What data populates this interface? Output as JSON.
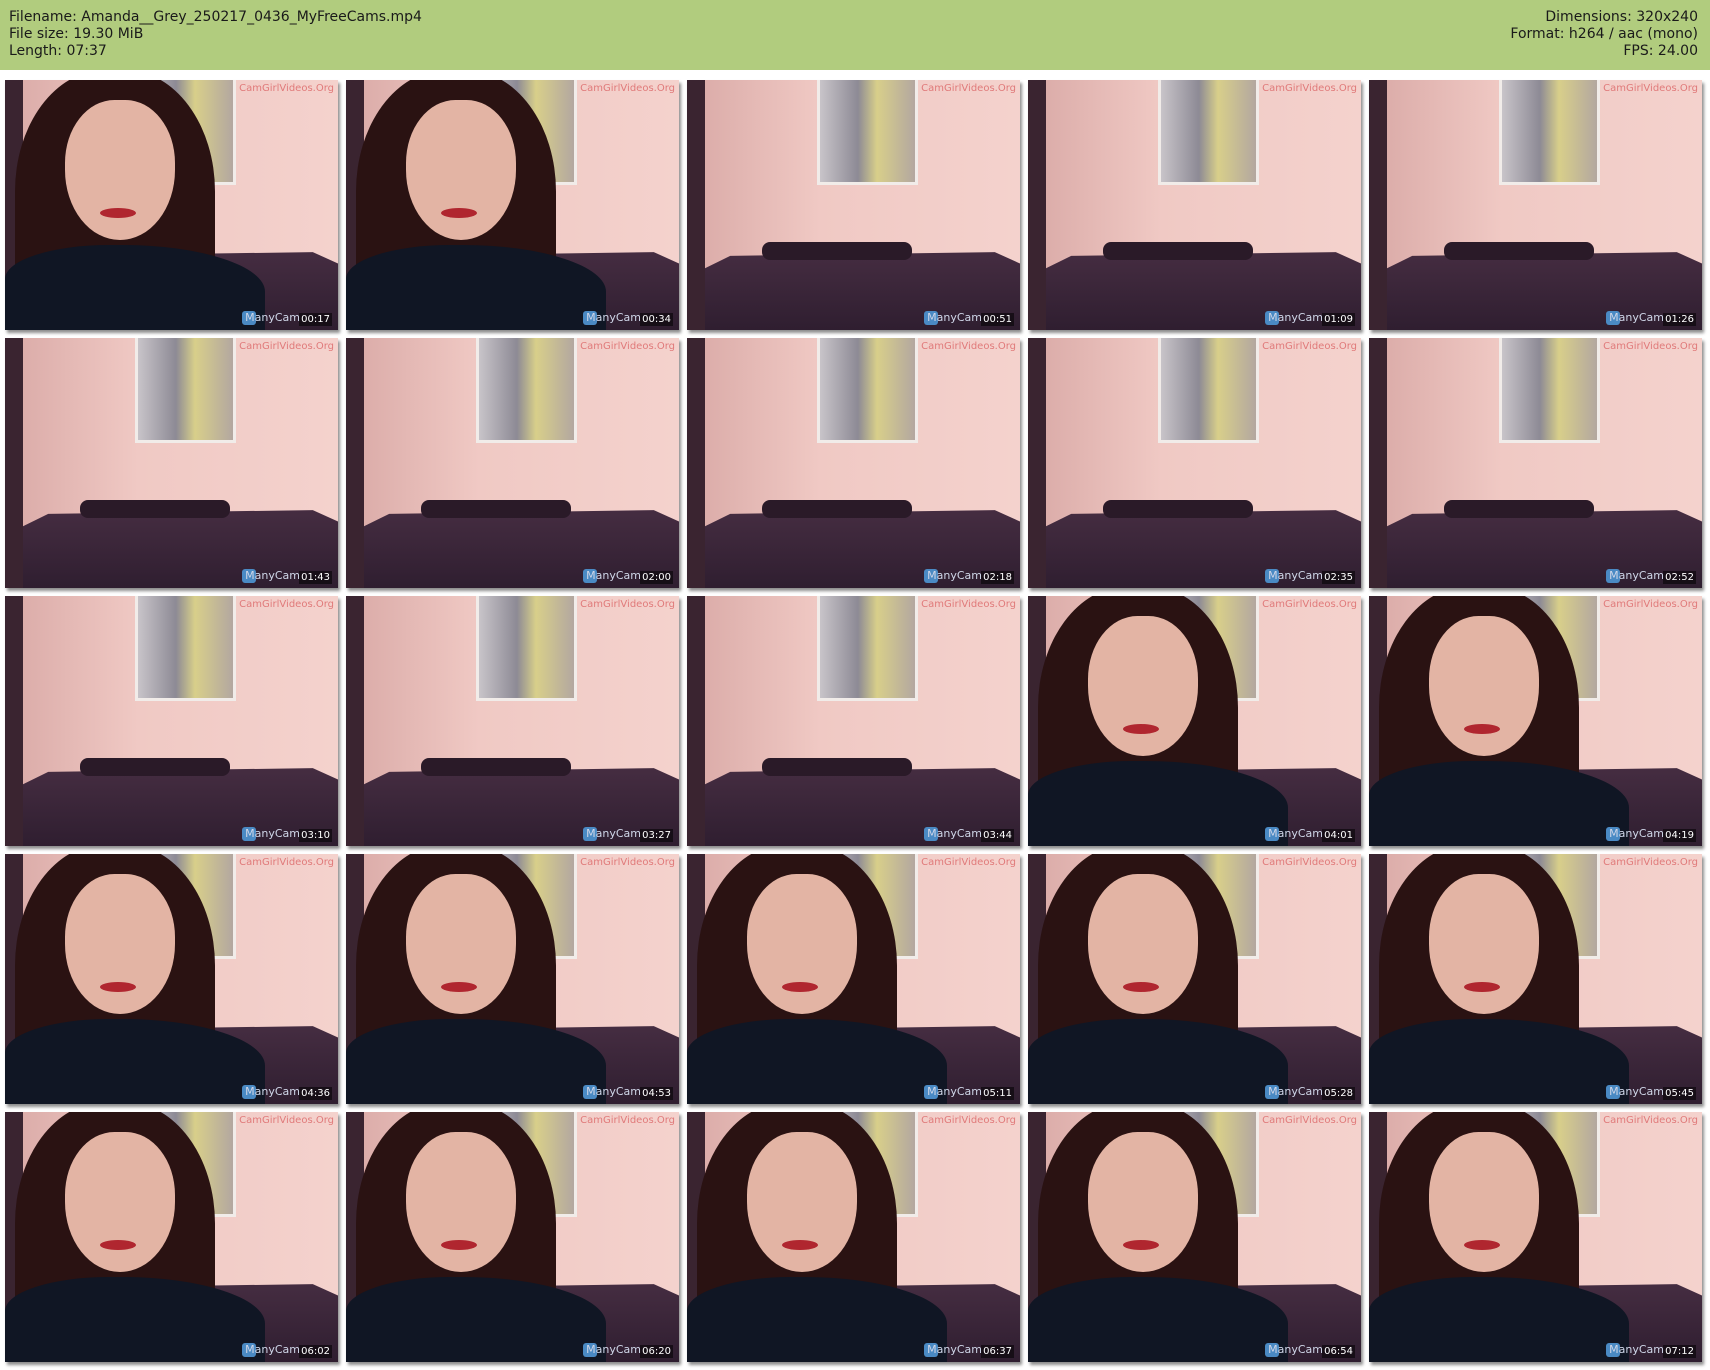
{
  "header": {
    "filename": "Filename: Amanda__Grey_250217_0436_MyFreeCams.mp4",
    "filesize": "File size: 19.30 MiB",
    "length": "Length: 07:37",
    "dimensions": "Dimensions: 320x240",
    "format": "Format: h264 / aac (mono)",
    "fps": "FPS: 24.00"
  },
  "watermark": "CamGirlVideos.Org",
  "overlay": "ManyCam",
  "thumbnails": [
    {
      "time": "00:17",
      "scene": "person"
    },
    {
      "time": "00:34",
      "scene": "person"
    },
    {
      "time": "00:51",
      "scene": "room"
    },
    {
      "time": "01:09",
      "scene": "room"
    },
    {
      "time": "01:26",
      "scene": "room"
    },
    {
      "time": "01:43",
      "scene": "room"
    },
    {
      "time": "02:00",
      "scene": "room"
    },
    {
      "time": "02:18",
      "scene": "room"
    },
    {
      "time": "02:35",
      "scene": "room"
    },
    {
      "time": "02:52",
      "scene": "room"
    },
    {
      "time": "03:10",
      "scene": "room"
    },
    {
      "time": "03:27",
      "scene": "room"
    },
    {
      "time": "03:44",
      "scene": "room"
    },
    {
      "time": "04:01",
      "scene": "person"
    },
    {
      "time": "04:19",
      "scene": "person"
    },
    {
      "time": "04:36",
      "scene": "person"
    },
    {
      "time": "04:53",
      "scene": "person"
    },
    {
      "time": "05:11",
      "scene": "person"
    },
    {
      "time": "05:28",
      "scene": "person"
    },
    {
      "time": "05:45",
      "scene": "person"
    },
    {
      "time": "06:02",
      "scene": "person"
    },
    {
      "time": "06:20",
      "scene": "person"
    },
    {
      "time": "06:37",
      "scene": "person"
    },
    {
      "time": "06:54",
      "scene": "person"
    },
    {
      "time": "07:12",
      "scene": "person"
    }
  ]
}
